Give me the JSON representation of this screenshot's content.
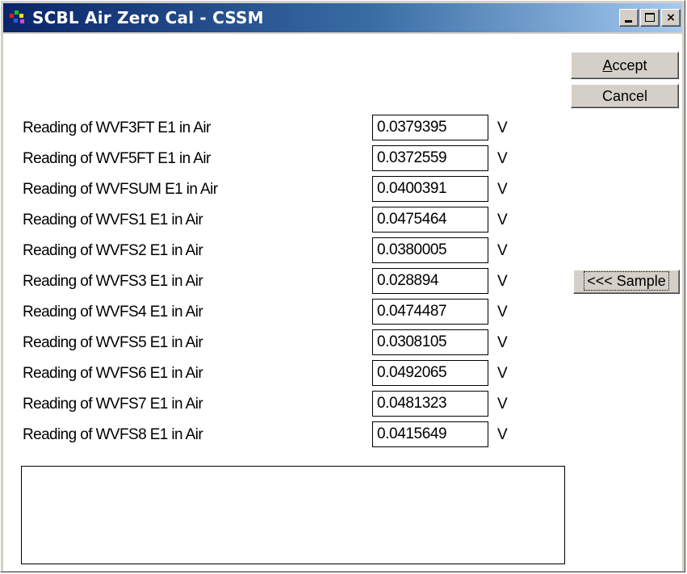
{
  "window": {
    "title": "SCBL Air Zero Cal - CSSM",
    "controls": {
      "minimize": "_",
      "maximize": "□",
      "close": "×"
    }
  },
  "buttons": {
    "accept_accel": "A",
    "accept_rest": "ccept",
    "cancel": "Cancel",
    "sample": "<<< Sample"
  },
  "readings": [
    {
      "label": "Reading of WVF3FT E1 in Air",
      "value": "0.0379395",
      "unit": "V"
    },
    {
      "label": "Reading of WVF5FT E1 in Air",
      "value": "0.0372559",
      "unit": "V"
    },
    {
      "label": "Reading of WVFSUM E1 in Air",
      "value": "0.0400391",
      "unit": "V"
    },
    {
      "label": "Reading of WVFS1 E1 in Air",
      "value": "0.0475464",
      "unit": "V"
    },
    {
      "label": "Reading of WVFS2 E1 in Air",
      "value": "0.0380005",
      "unit": "V"
    },
    {
      "label": "Reading of WVFS3 E1 in Air",
      "value": "0.028894",
      "unit": "V"
    },
    {
      "label": "Reading of WVFS4 E1 in Air",
      "value": "0.0474487",
      "unit": "V"
    },
    {
      "label": "Reading of WVFS5 E1 in Air",
      "value": "0.0308105",
      "unit": "V"
    },
    {
      "label": "Reading of WVFS6 E1 in Air",
      "value": "0.0492065",
      "unit": "V"
    },
    {
      "label": "Reading of WVFS7 E1 in Air",
      "value": "0.0481323",
      "unit": "V"
    },
    {
      "label": "Reading of WVFS8 E1 in Air",
      "value": "0.0415649",
      "unit": "V"
    }
  ],
  "message_box": {
    "text": ""
  },
  "colors": {
    "titlebar_start": "#0a246a",
    "titlebar_end": "#a6caf0",
    "button_face": "#d4d0c8"
  }
}
